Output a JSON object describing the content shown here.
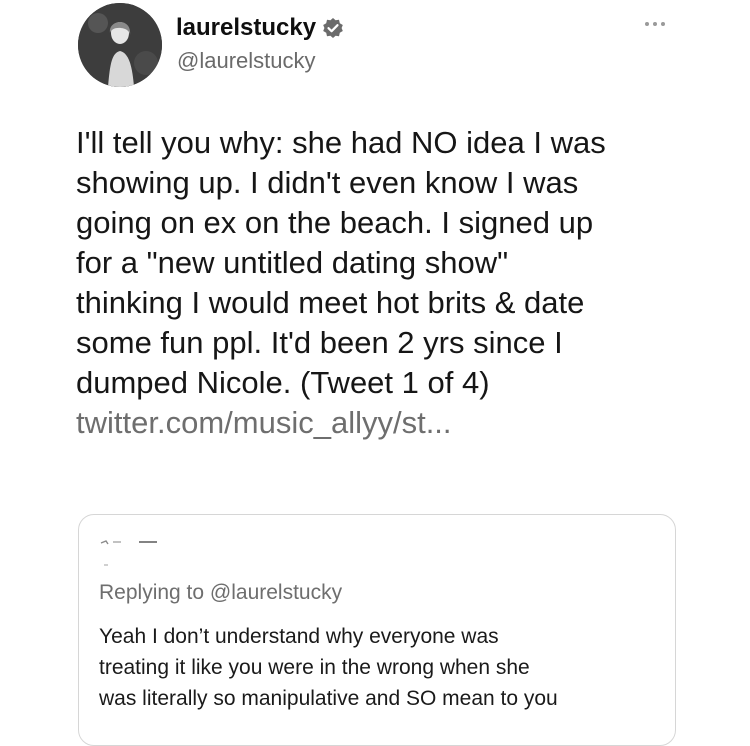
{
  "author": {
    "display_name": "laurelstucky",
    "handle": "@laurelstucky",
    "verified_icon": "verified-badge-icon",
    "avatar_icon": "profile-photo"
  },
  "menu": {
    "more_icon": "more-options-icon"
  },
  "tweet": {
    "lines": [
      "I'll tell you why: she had NO idea I was",
      "showing up. I didn't even know I was",
      "going on ex on the beach. I signed up",
      "for a \"new untitled dating show\"",
      "thinking I would meet hot brits & date",
      "some fun ppl. It'd been 2 yrs since I",
      "dumped Nicole. (Tweet 1 of 4)"
    ],
    "link": "twitter.com/music_allyy/st..."
  },
  "quote": {
    "replying_to_prefix": "Replying to ",
    "replying_to_handle": "@laurelstucky",
    "lines": [
      "Yeah I don’t understand why everyone was",
      "treating it like you were in the wrong when she",
      "was literally so manipulative and SO mean to you"
    ]
  },
  "colors": {
    "text": "#161616",
    "secondary_text": "#6e6e6e",
    "border": "#d6d6d6",
    "background": "#ffffff"
  }
}
